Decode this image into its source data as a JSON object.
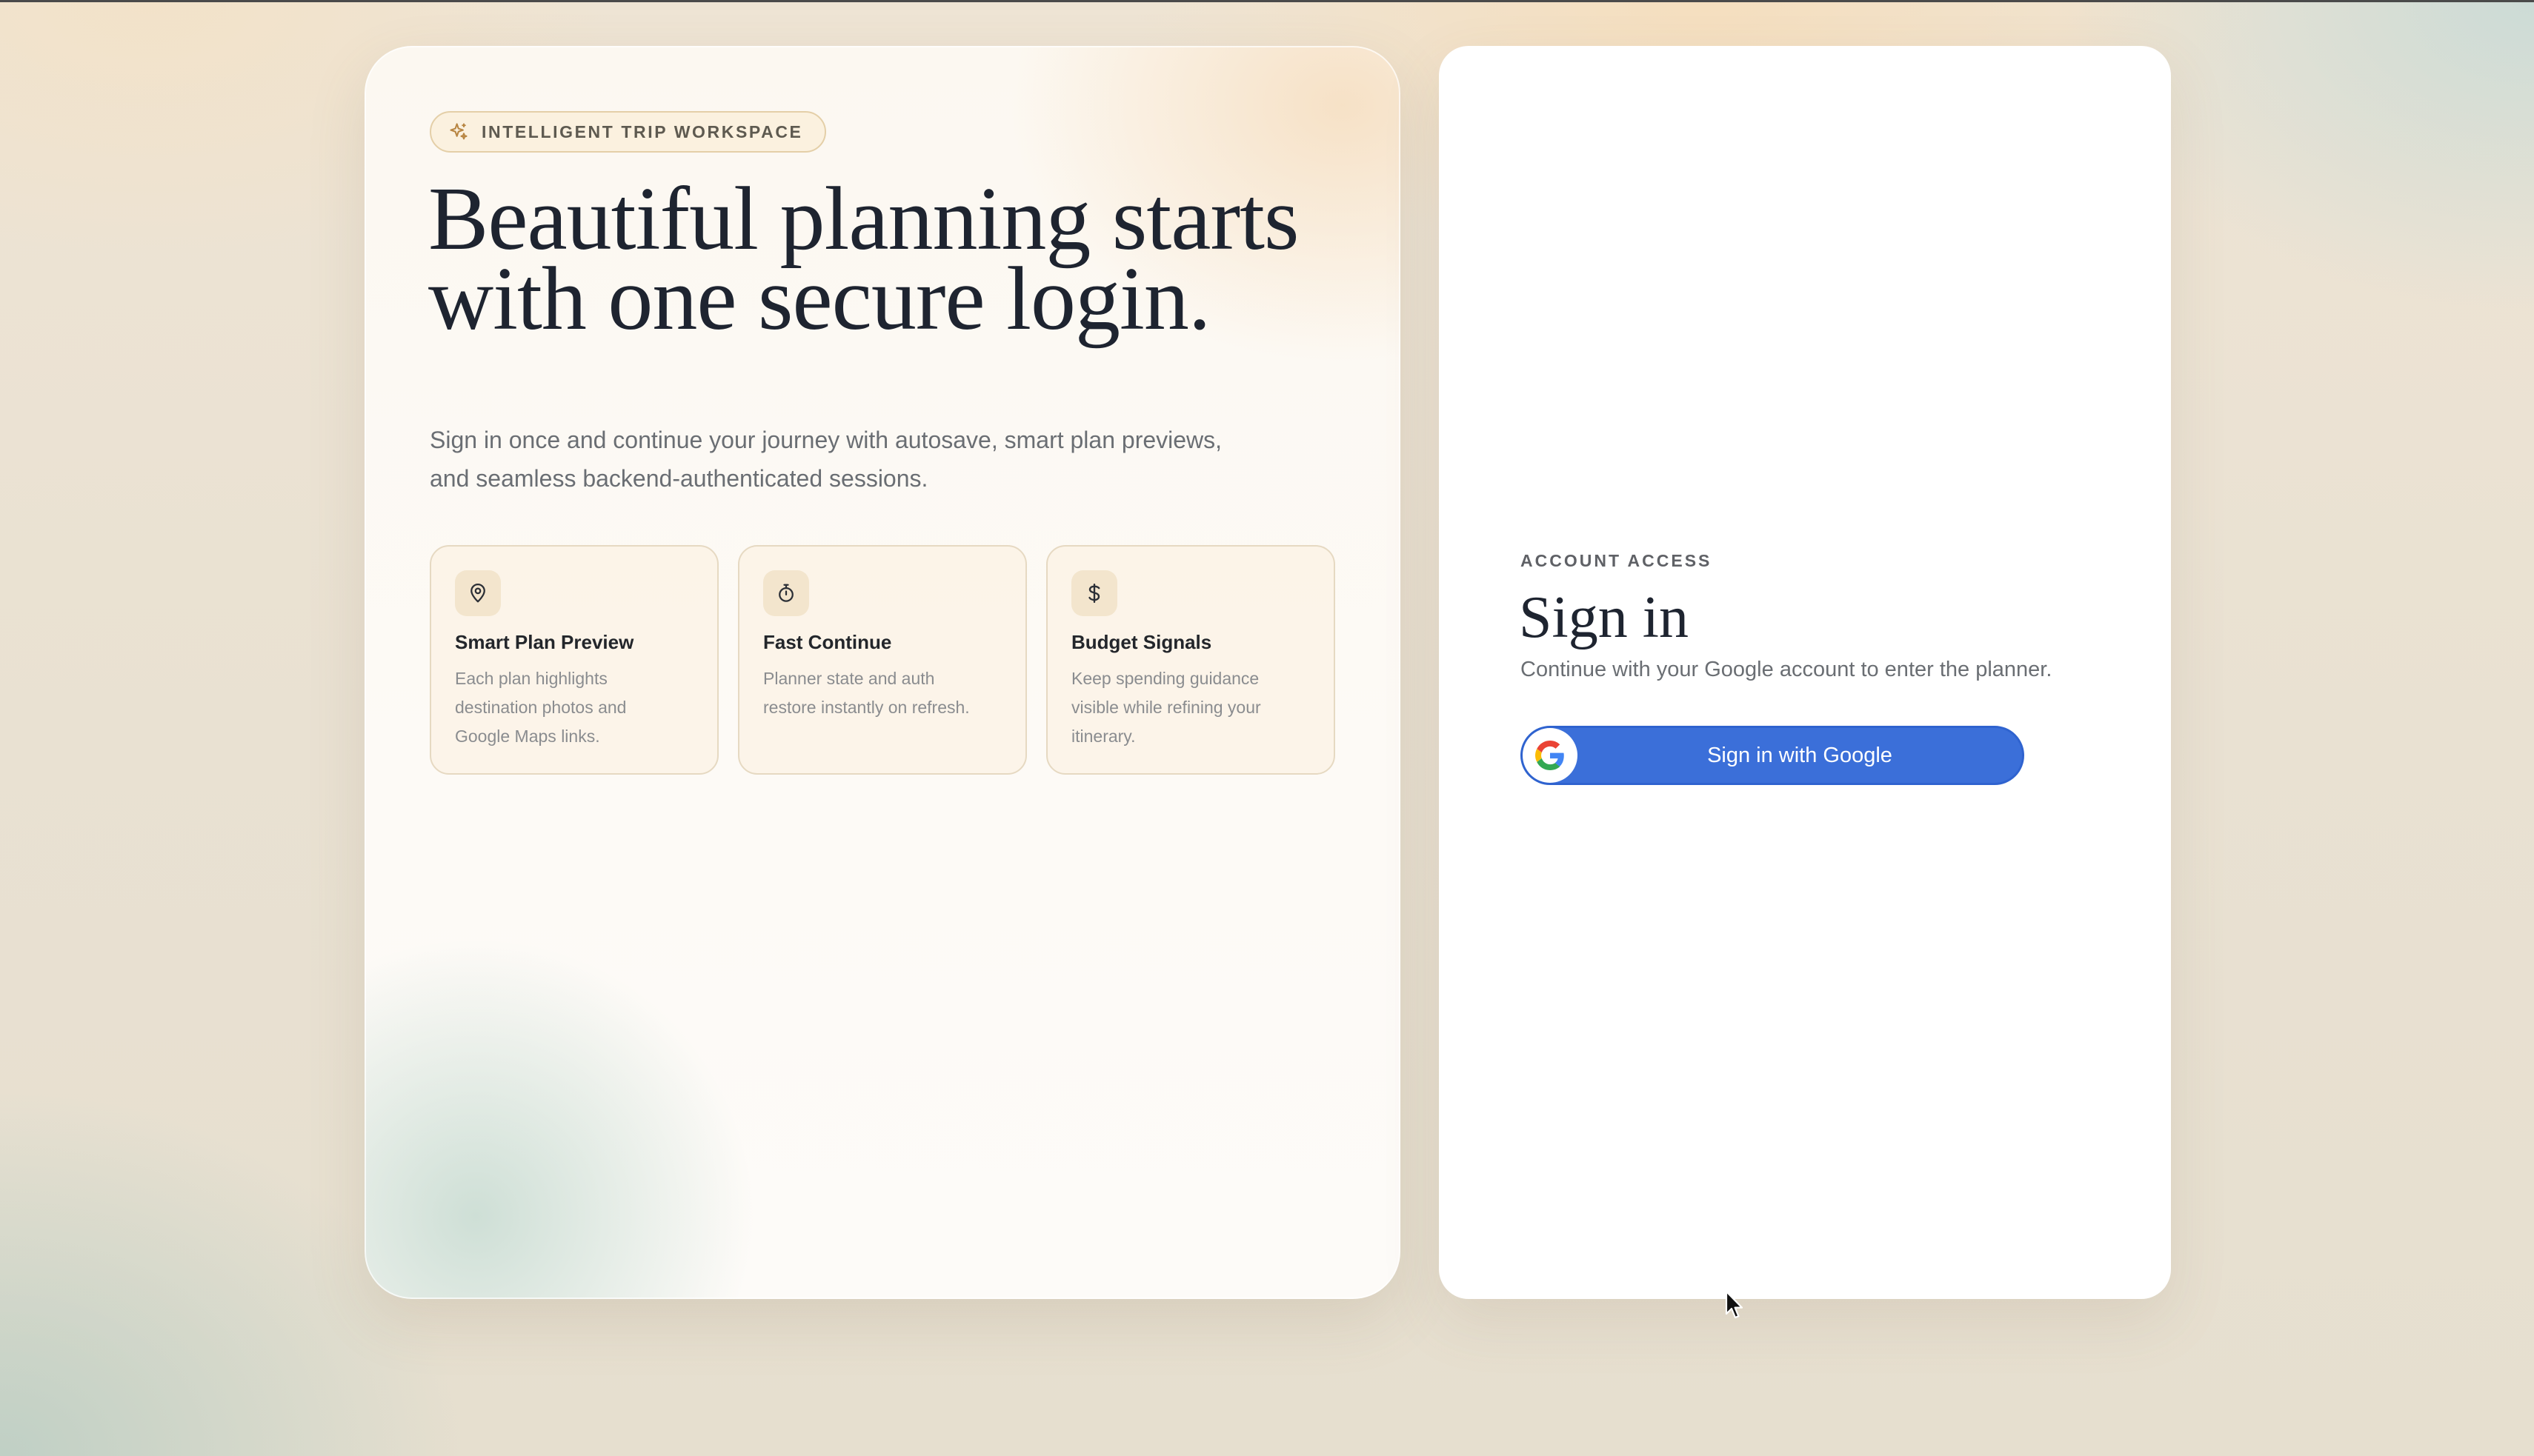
{
  "hero": {
    "badge": {
      "icon": "sparkles-icon",
      "label": "INTELLIGENT TRIP WORKSPACE"
    },
    "headline_line1": "Beautiful planning starts",
    "headline_line2": "with one secure login.",
    "subtext_line1": "Sign in once and continue your journey with autosave, smart plan previews,",
    "subtext_line2": "and seamless backend-authenticated sessions.",
    "features": [
      {
        "icon": "map-pin-icon",
        "title": "Smart Plan Preview",
        "desc_lines": [
          "Each plan highlights",
          "destination photos and",
          "Google Maps links."
        ]
      },
      {
        "icon": "stopwatch-icon",
        "title": "Fast Continue",
        "desc_lines": [
          "Planner state and auth",
          "restore instantly on refresh."
        ]
      },
      {
        "icon": "dollar-icon",
        "title": "Budget Signals",
        "desc_lines": [
          "Keep spending guidance",
          "visible while refining your",
          "itinerary."
        ]
      }
    ]
  },
  "signin": {
    "eyebrow": "ACCOUNT ACCESS",
    "title": "Sign in",
    "subtitle": "Continue with your Google account to enter the planner.",
    "google_button_label": "Sign in with Google",
    "google_icon": "google-g-icon"
  },
  "colors": {
    "accent_blue": "#3b6fd9",
    "badge_bg": "#fbf1df",
    "feature_bg": "#fbf2e4",
    "heading": "#1e2430"
  }
}
